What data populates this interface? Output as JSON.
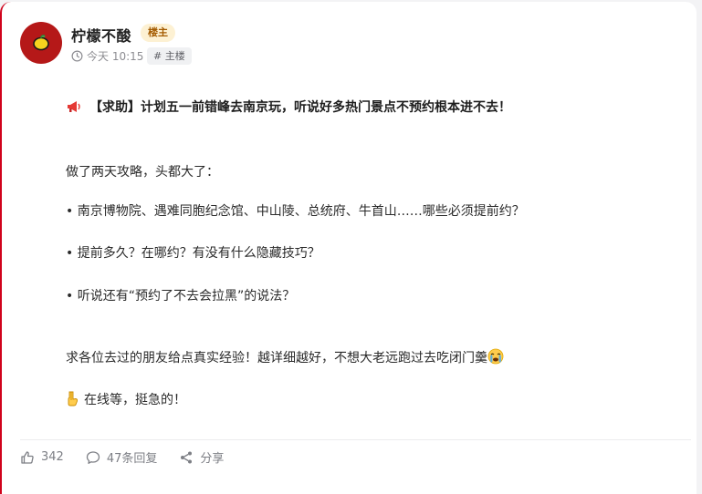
{
  "post": {
    "author": {
      "name": "柠檬不酸",
      "badge": "楼主",
      "avatar_icon": "lemon-icon"
    },
    "time": "今天 10:15",
    "floor_tag": "# 主楼",
    "title_icon": "megaphone-icon",
    "title": "【求助】计划五一前错峰去南京玩，听说好多热门景点不预约根本进不去！",
    "intro": "做了两天攻略，头都大了：",
    "bullets": [
      "• 南京博物院、遇难同胞纪念馆、中山陵、总统府、牛首山……哪些必须提前约？",
      "• 提前多久？在哪约？有没有什么隐藏技巧？",
      "• 听说还有“预约了不去会拉黑”的说法？"
    ],
    "plea": "求各位去过的朋友给点真实经验！越详细越好，不想大老远跑过去吃闭门羹",
    "plea_emoji": "crying-face-icon",
    "waiting_icon": "pointing-down-icon",
    "waiting": "在线等，挺急的！"
  },
  "actions": {
    "likes": "342",
    "replies": "47条回复",
    "share": "分享"
  },
  "colors": {
    "accent_border": "#d0021b",
    "avatar_bg": "#b51818",
    "badge_bg": "#fdf1d3",
    "badge_text": "#a45b00"
  }
}
